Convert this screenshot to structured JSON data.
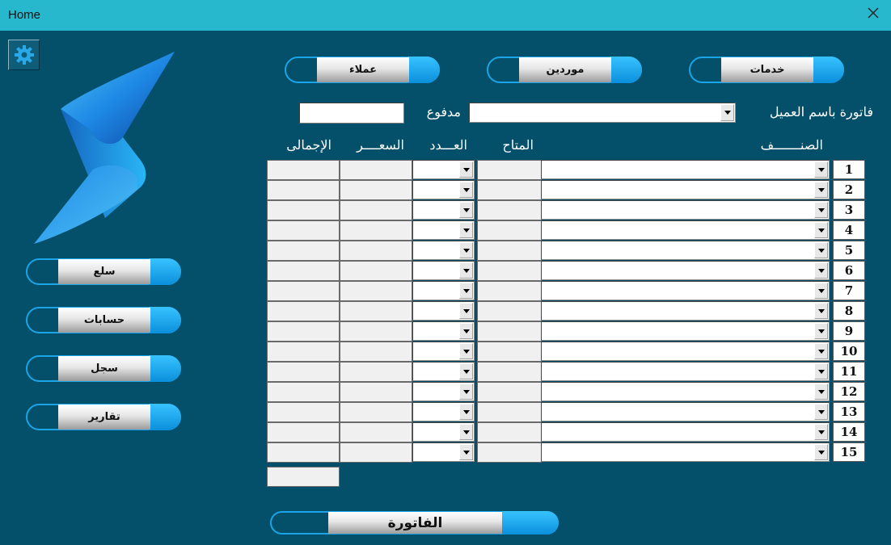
{
  "window": {
    "title": "Home"
  },
  "top_buttons": {
    "services": "خدمات",
    "suppliers": "موردين",
    "customers": "عملاء"
  },
  "side_buttons": {
    "goods": "سلع",
    "accounts": "حسابات",
    "log": "سجل",
    "reports": "تقارير"
  },
  "invoice_form": {
    "customer_label": "فاتورة باسم العميل",
    "paid_label": "مدفوع",
    "customer_value": "",
    "paid_value": ""
  },
  "columns": {
    "item": "الصنـــــــف",
    "available": "المتاح",
    "quantity": "العـــدد",
    "price": "السعــــر",
    "total": "الإجمالى"
  },
  "rows": [
    {
      "n": "1"
    },
    {
      "n": "2"
    },
    {
      "n": "3"
    },
    {
      "n": "4"
    },
    {
      "n": "5"
    },
    {
      "n": "6"
    },
    {
      "n": "7"
    },
    {
      "n": "8"
    },
    {
      "n": "9"
    },
    {
      "n": "10"
    },
    {
      "n": "11"
    },
    {
      "n": "12"
    },
    {
      "n": "13"
    },
    {
      "n": "14"
    },
    {
      "n": "15"
    }
  ],
  "grand_total": "",
  "invoice_button": "الفاتورة",
  "colors": {
    "background": "#04506a",
    "titlebar": "#27b8cd",
    "accent": "#1aa5e8"
  },
  "icons": {
    "settings": "gear-icon",
    "close": "close-icon",
    "logo": "lightning-logo"
  }
}
